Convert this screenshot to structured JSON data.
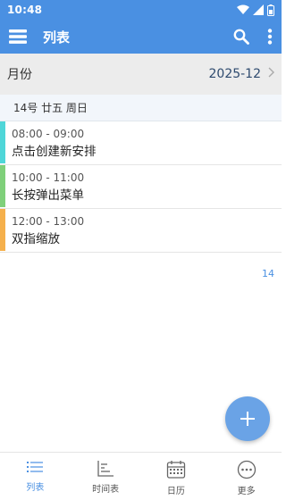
{
  "status_bar": {
    "time": "10:48"
  },
  "app_bar": {
    "title": "列表"
  },
  "month_row": {
    "label": "月份",
    "value": "2025-12"
  },
  "day_header": {
    "text": "14号 廿五 周日"
  },
  "events": [
    {
      "time": "08:00 - 09:00",
      "title": "点击创建新安排",
      "color": "#4fd6d8"
    },
    {
      "time": "10:00 - 11:00",
      "title": "长按弹出菜单",
      "color": "#7fd07a"
    },
    {
      "time": "12:00 - 13:00",
      "title": "双指缩放",
      "color": "#f5b04c"
    }
  ],
  "day_count": "14",
  "bottom_nav": [
    {
      "label": "列表",
      "icon": "list-icon",
      "active": true
    },
    {
      "label": "时间表",
      "icon": "timeline-icon",
      "active": false
    },
    {
      "label": "日历",
      "icon": "calendar-icon",
      "active": false
    },
    {
      "label": "更多",
      "icon": "more-icon",
      "active": false
    }
  ],
  "colors": {
    "primary": "#4a90e2",
    "fab": "#6aa3e6"
  }
}
